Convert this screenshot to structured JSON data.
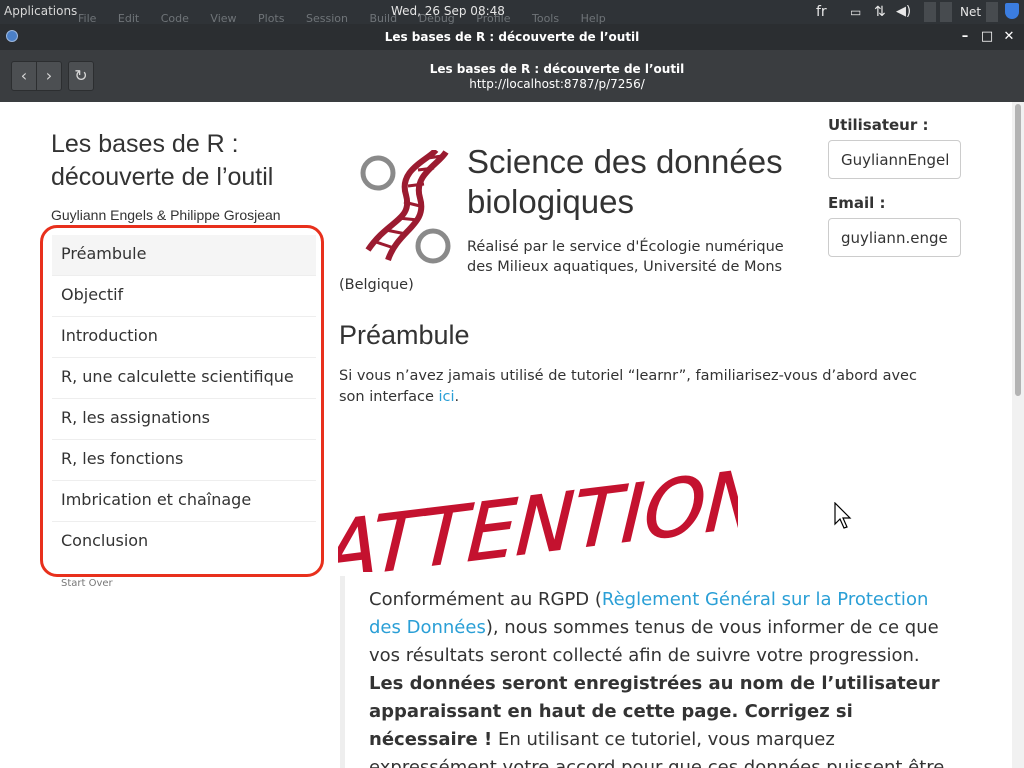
{
  "system_bar": {
    "applications": "Applications",
    "ghost_menu": [
      "File",
      "Edit",
      "Code",
      "View",
      "Plots",
      "Session",
      "Build",
      "Debug",
      "Profile",
      "Tools",
      "Help"
    ],
    "clock": "Wed, 26 Sep  08:48",
    "keyboard_layout": "fr",
    "network_label": "Net"
  },
  "window": {
    "title": "Les bases de R : découverte de l’outil"
  },
  "browser": {
    "page_title": "Les bases de R : découverte de l’outil",
    "url": "http://localhost:8787/p/7256/"
  },
  "sidebar": {
    "title": "Les bases de R : découverte de l’outil",
    "authors": "Guyliann Engels & Philippe Grosjean",
    "items": [
      {
        "label": "Préambule",
        "active": true
      },
      {
        "label": "Objectif"
      },
      {
        "label": "Introduction"
      },
      {
        "label": "R, une calculette scientifique"
      },
      {
        "label": "R, les assignations"
      },
      {
        "label": "R, les fonctions"
      },
      {
        "label": "Imbrication et chaînage"
      },
      {
        "label": "Conclusion"
      }
    ],
    "start_over": "Start Over",
    "highlight_color": "#e8301c"
  },
  "header": {
    "site_title": "Science des données biologiques",
    "subtitle": "Réalisé par le service d'Écologie numérique des Milieux aquatiques, Université de Mons",
    "subtitle_tail": "(Belgique)"
  },
  "user_form": {
    "user_label": "Utilisateur :",
    "user_value": "GuyliannEngels",
    "email_label": "Email :",
    "email_value": "guyliann.engels@umons.ac.be"
  },
  "main": {
    "section_title": "Préambule",
    "intro_before": "Si vous n’avez jamais utilisé de tutoriel “learnr”, familiarisez-vous d’abord avec son interface ",
    "intro_link": "ici",
    "intro_after": ".",
    "attention_text": "ATTENTION!",
    "quote_before": "Conformément au RGPD (",
    "quote_link": "Règlement Général sur la Protection des Données",
    "quote_mid": "), nous sommes tenus de vous informer de ce que vos résultats seront collecté afin de suivre votre progression. ",
    "quote_bold": "Les données seront enregistrées au nom de l’utilisateur apparaissant en haut de cette page. Corrigez si nécessaire !",
    "quote_after": " En utilisant ce tutoriel, vous marquez expressément votre accord pour que ces données puissent être"
  },
  "colors": {
    "link": "#2a9fd6",
    "attention_red": "#c4122f",
    "logo_dna": "#9b1b30"
  },
  "icons": [
    "back-icon",
    "forward-icon",
    "reload-icon",
    "minimize-icon",
    "maximize-icon",
    "close-icon",
    "mouse-cursor-icon"
  ]
}
